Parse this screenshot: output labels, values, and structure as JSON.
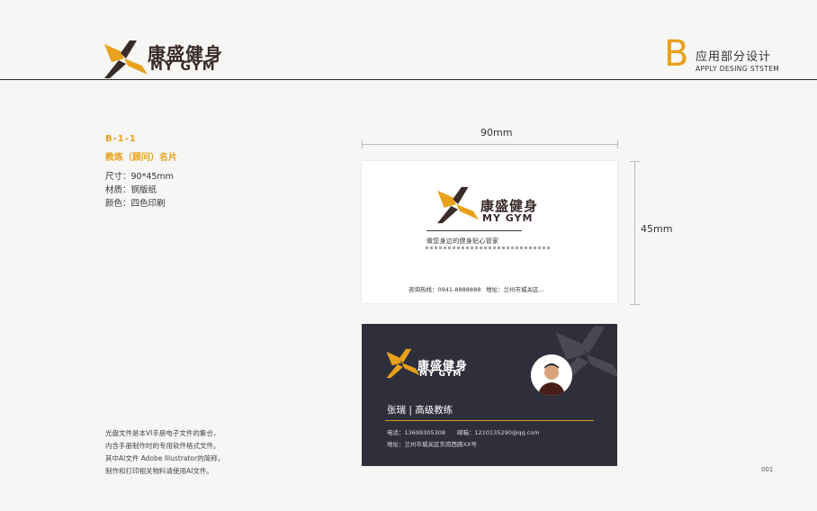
{
  "header": {
    "logo_cn": "康盛健身",
    "logo_en": "MY GYM",
    "section_letter": "B",
    "section_cn": "应用部分设计",
    "section_en": "APPLY DESING STSTEM"
  },
  "spec": {
    "code": "B-1-1",
    "title": "教练（顾问）名片",
    "size": "尺寸：90*45mm",
    "material": "材质：铜版纸",
    "color": "颜色：四色印刷"
  },
  "dimensions": {
    "width_label": "90mm",
    "height_label": "45mm"
  },
  "card_front": {
    "logo_cn": "康盛健身",
    "logo_en": "MY GYM",
    "slogan": "做您身边的健身贴心管家",
    "contact_left": "咨询热线：0941-8888888",
    "contact_right": "地址：兰州市城关区..."
  },
  "card_back": {
    "logo_cn": "康盛健身",
    "logo_en": "MY GYM",
    "name_title": "张瑞 | 高级教练",
    "phone": "电话：13699305308",
    "email": "邮箱：1210135290@qq.com",
    "address": "地址：兰州市城关区东岗西路XX号"
  },
  "notes": [
    "光盘文件是本VI手册电子文件的集合，",
    "内含手册制作时的专用软件格式文件。",
    "其中AI文件 Adobe Illustrator的简称，",
    "制作和打印相关物料请使用AI文件。"
  ],
  "page_number": "001",
  "colors": {
    "accent": "#e8a11c",
    "dark_card": "#2e2f3a",
    "logo_brown": "#3a2a2a"
  }
}
